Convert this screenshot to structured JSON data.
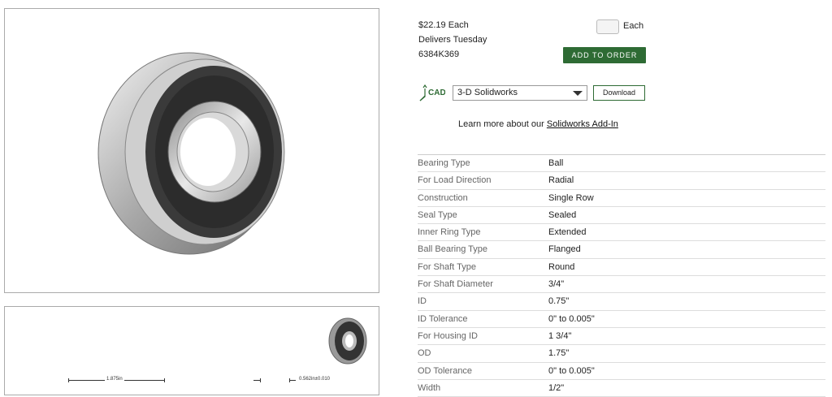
{
  "product": {
    "price": "$22.19 Each",
    "delivery": "Delivers Tuesday",
    "part_number": "6384K369"
  },
  "order": {
    "unit_label": "Each",
    "add_button": "ADD TO ORDER"
  },
  "cad": {
    "icon_label": "CAD",
    "format_selected": "3-D Solidworks",
    "download_label": "Download"
  },
  "learn_more": {
    "prefix": "Learn more about our",
    "link": "Solidworks Add-In"
  },
  "drawing": {
    "dim_outer": "1.875in",
    "dim_width": "0.562in±0.010"
  },
  "specs": [
    {
      "key": "Bearing Type",
      "value": "Ball"
    },
    {
      "key": "For Load Direction",
      "value": "Radial"
    },
    {
      "key": "Construction",
      "value": "Single Row"
    },
    {
      "key": "Seal Type",
      "value": "Sealed"
    },
    {
      "key": "Inner Ring Type",
      "value": "Extended"
    },
    {
      "key": "Ball Bearing Type",
      "value": "Flanged"
    },
    {
      "key": "For Shaft Type",
      "value": "Round"
    },
    {
      "key": "For Shaft Diameter",
      "value": "3/4\""
    },
    {
      "key": "ID",
      "value": "0.75\""
    },
    {
      "key": "ID Tolerance",
      "value": "0\" to 0.005\""
    },
    {
      "key": "For Housing ID",
      "value": "1 3/4\""
    },
    {
      "key": "OD",
      "value": "1.75\""
    },
    {
      "key": "OD Tolerance",
      "value": "0\" to 0.005\""
    },
    {
      "key": "Width",
      "value": "1/2\""
    }
  ],
  "colors": {
    "accent_green": "#2e6b34"
  }
}
